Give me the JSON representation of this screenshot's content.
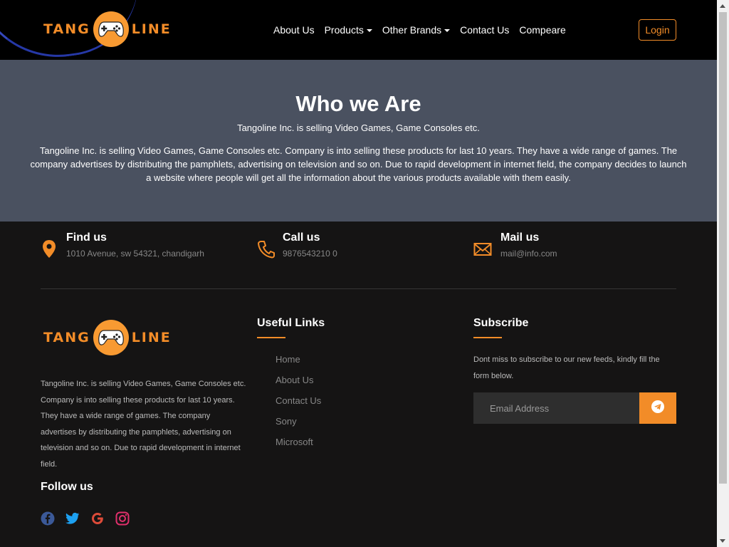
{
  "brand": {
    "left": "TANG",
    "right": "LINE",
    "accent": "#f28c28",
    "logo_icon": "gamepad-icon"
  },
  "nav": {
    "items": [
      {
        "label": "About Us"
      },
      {
        "label": "Products"
      },
      {
        "label": "Other Brands"
      },
      {
        "label": "Contact Us"
      },
      {
        "label": "Compeare"
      }
    ],
    "login": "Login"
  },
  "hero": {
    "title": "Who we Are",
    "subtitle": "Tangoline Inc. is selling Video Games, Game Consoles etc.",
    "paragraph": "Tangoline Inc. is selling Video Games, Game Consoles etc. Company is into selling these products for last 10 years. They have a wide range of games. The company advertises by distributing the pamphlets, advertising on television and so on. Due to rapid development in internet field, the company decides to launch a website where people will get all the information about the various products available with them easily."
  },
  "contact": {
    "find": {
      "title": "Find us",
      "info": "1010 Avenue, sw 54321, chandigarh",
      "icon": "map-pin-icon"
    },
    "call": {
      "title": "Call us",
      "info": "9876543210 0",
      "icon": "phone-icon"
    },
    "mail": {
      "title": "Mail us",
      "info": "mail@info.com",
      "icon": "envelope-icon"
    }
  },
  "footer": {
    "about": "Tangoline Inc. is selling Video Games, Game Consoles etc. Company is into selling these products for last 10 years. They have a wide range of games. The company advertises by distributing the pamphlets, advertising on television and so on. Due to rapid development in internet field.",
    "follow_title": "Follow us",
    "social": [
      "facebook-icon",
      "twitter-icon",
      "google-icon",
      "instagram-icon"
    ],
    "useful_links_title": "Useful Links",
    "useful_links": [
      "Home",
      "About Us",
      "Contact Us",
      "Sony",
      "Microsoft"
    ],
    "subscribe_title": "Subscribe",
    "subscribe_text": "Dont miss to subscribe to our new feeds, kindly fill the form below.",
    "email_placeholder": "Email Address"
  }
}
